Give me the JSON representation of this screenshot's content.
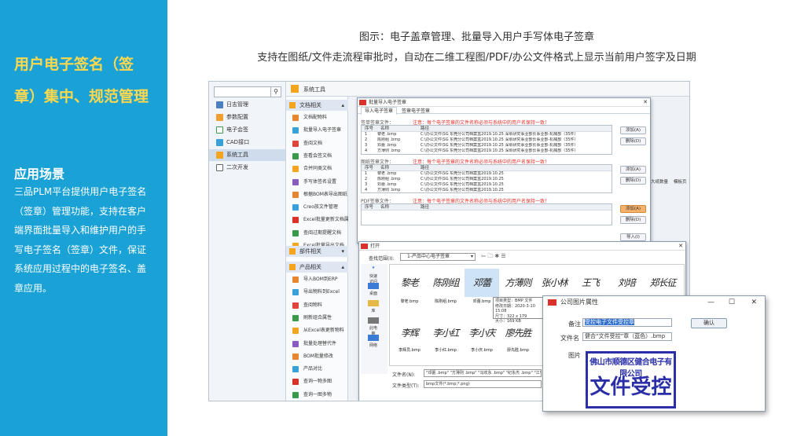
{
  "left": {
    "title": "用户电子签名（签章）集中、规范管理",
    "sub": "应用场景",
    "body": "三品PLM平台提供用户电子签名（签章）管理功能，支持在客户端界面批量导入和维护用户的手写电子签名（签章）文件，保证系统应用过程中的电子签名、盖章应用。"
  },
  "captions": {
    "c1": "图示：电子盖章管理、批量导入用户手写体电子签章",
    "c2": "支持在图纸/文件走流程审批时，自动在二维工程图/PDF/办公文件格式上显示当前用户签字及日期"
  },
  "nav": {
    "items": [
      "日志管理",
      "参数配置",
      "电子会签",
      "CAD接口",
      "系统工具",
      "二次开发"
    ],
    "search_icon": "search-icon"
  },
  "toolbar": {
    "title": "系统工具"
  },
  "menu": {
    "group1": "文档相关",
    "items1": [
      "文档配物料",
      "批量导入电子签章",
      "查阅文档",
      "查看会签文档",
      "合并同类文档",
      "手写体签名设置",
      "根据BOM表导出图纸",
      "Creo族文件管理",
      "Excel批量更新文档属性",
      "查阅过期提醒文档",
      "Excel批量导出文档"
    ],
    "group2": "部件相关",
    "group3": "产品相关",
    "items3": [
      "导入BOM到ERP",
      "导出物料到Excel",
      "查阅物料",
      "刷新组合属性",
      "从Excel表更新物料",
      "批量处理替代件",
      "BOM批量修改",
      "产品对比",
      "查询一物多图",
      "查询一图多物",
      "从Excel表更新BOM"
    ]
  },
  "dlg1": {
    "title": "批量导入电子签章",
    "tabs": [
      "导入电子签章",
      "签章电子签章"
    ],
    "sec1": "签单签章文件：",
    "sec2": "图纸签章文件：",
    "sec3": "PDF签章文件：",
    "warn": "注意：每个电子签章的文件名称必须与系统中的用户名保持一致！",
    "col_no": "序号",
    "col_name": "名称",
    "col_path": "路径",
    "rows1": [
      [
        "1",
        "黎老 .bmp",
        "C:\\办公文件\\SG 东莞分公司档案盒2019.10.25 深圳研究事业部长事业部-机械部（35件）"
      ],
      [
        "2",
        "陈刚组 .bmp",
        "C:\\办公文件\\SG 东莞分公司档案盒2019.10.25 深圳研究事业部长事业部-机械部（35件）"
      ],
      [
        "3",
        "邓蕾 .bmp",
        "C:\\办公文件\\SG 东莞分公司档案盒2019.10.25 深圳研究事业部长事业部-机械部（35件）"
      ],
      [
        "4",
        "方薄则 .bmp",
        "C:\\办公文件\\SG 东莞分公司档案盒2019.10.25 深圳研究事业部长事业部-机械部（35件）"
      ]
    ],
    "rows2": [
      [
        "1",
        "黎老 .bmp",
        "C:\\办公文件\\SG 东莞分公司档案盒2019.10.25"
      ],
      [
        "2",
        "陈刚组 .bmp",
        "C:\\办公文件\\SG 东莞分公司档案盒2019.10.25"
      ],
      [
        "3",
        "邓蕾 .bmp",
        "C:\\办公文件\\SG 东莞分公司档案盒2019.10.25"
      ],
      [
        "4",
        "方薄则 .bmp",
        "C:\\办公文件\\SG 东莞分公司档案盒2019.10.25"
      ]
    ],
    "btn_add": "添加(A)",
    "btn_del": "删除(D)",
    "btn_import": "导入(I)",
    "extra_cols": [
      "大纸数量",
      "模板页"
    ]
  },
  "dlg2": {
    "title": "打开",
    "lookin_label": "查找范围(I):",
    "lookin_value": "1-产品中心电子签章",
    "places": [
      "快速访问",
      "桌面",
      "库",
      "此电脑",
      "网络"
    ],
    "sigs_row1": [
      "黎老",
      "陈刚组",
      "邓蕾",
      "方薄则",
      "张小林",
      "王飞",
      "刘培",
      "郑长征"
    ],
    "files_row1": [
      "黎老.bmp",
      "陈刚组.bmp",
      "邓蕾.bmp"
    ],
    "sigs_row2": [
      "李辉",
      "李小红",
      "李小庆",
      "廖先胜",
      "刘"
    ],
    "files_row2": [
      "李辉员.bmp",
      "李小红.bmp",
      "李小庆.bmp",
      "廖先胜.bmp",
      "刘昭"
    ],
    "tooltip": [
      "项目类型：BMP 文件",
      "修改日期：2020-3-10 15:08",
      "尺寸：322 x 179",
      "大小：169 KB"
    ],
    "fn_label": "文件名(N):",
    "fn_value": "\"邓蕾 .bmp\" \"方薄则 .bmp\" \"冯欢永 .bmp\" \"纪永杰 .bmp\" \"江宇弘 .bmp\"",
    "ft_label": "文件类型(T):",
    "ft_value": "bmp文件(*.bmp;*.png)"
  },
  "prop": {
    "title": "公司图片属性",
    "label_note": "备注",
    "note_value": "受控电子文件受控章",
    "label_file": "文件名",
    "file_value": "健合“文件受控”章（蓝色）.bmp",
    "label_pic": "图片",
    "confirm": "确认",
    "stamp_top": "佛山市顺德区健合电子有限公司",
    "stamp_main": "文件受控"
  },
  "colors": {
    "left_bg": "#1aa2d6",
    "title_yellow": "#ffd84d",
    "stamp_blue": "#2a2fa8"
  }
}
